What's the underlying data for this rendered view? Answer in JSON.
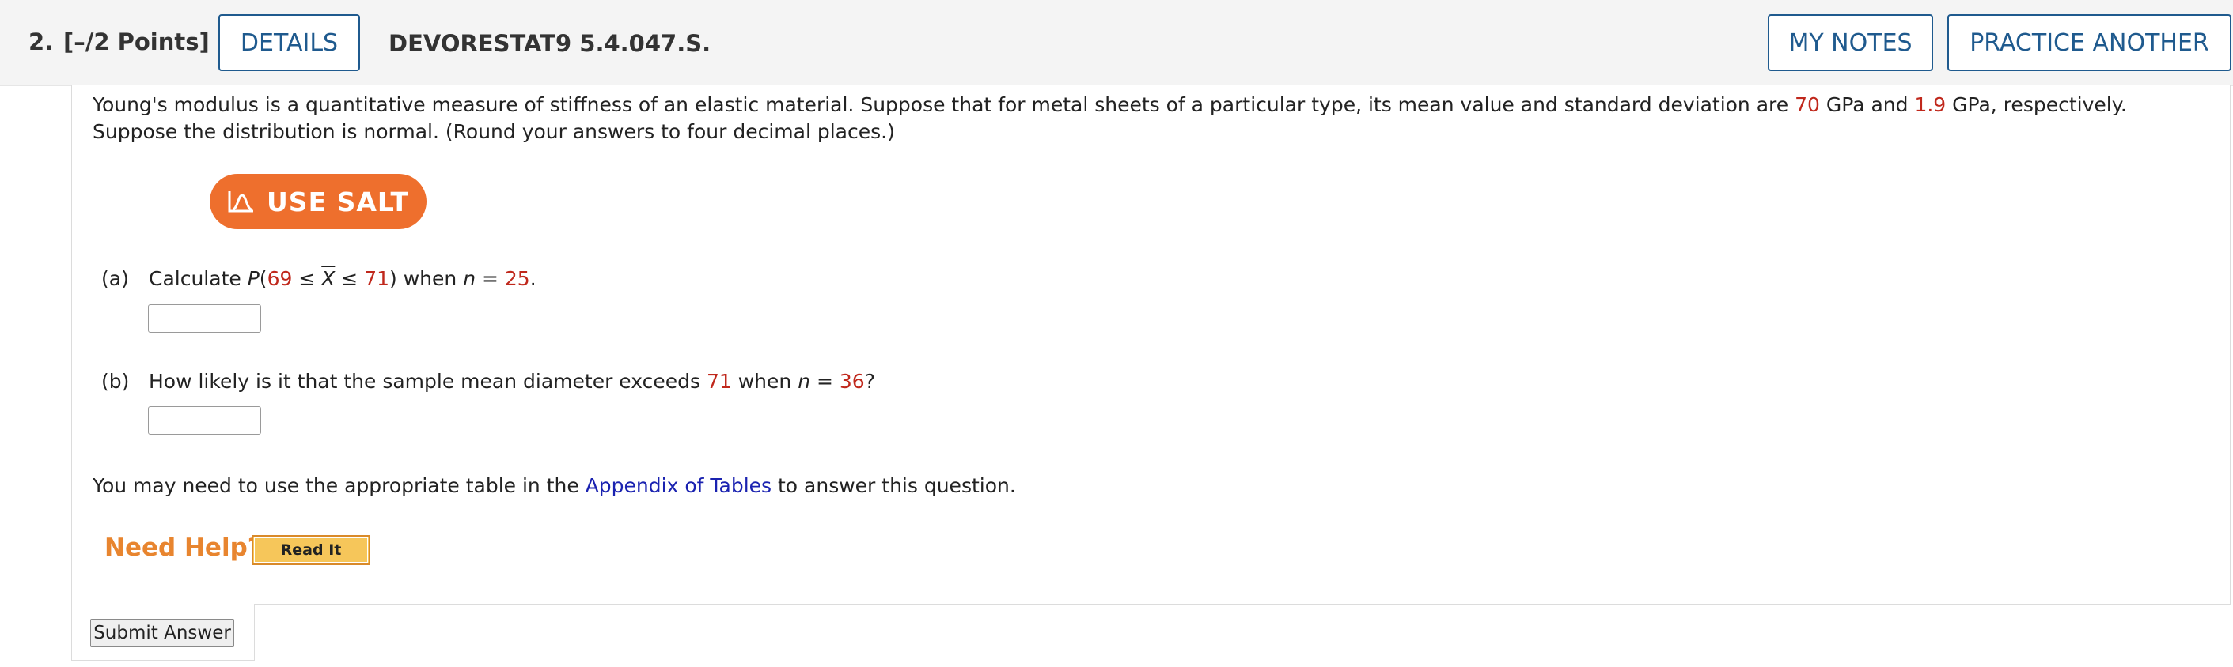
{
  "header": {
    "number": "2.",
    "points": "[–/2 Points]",
    "details_label": "DETAILS",
    "assignment": "DEVORESTAT9 5.4.047.S.",
    "my_notes_label": "MY NOTES",
    "practice_label": "PRACTICE ANOTHER"
  },
  "question": {
    "intro_1": "Young's modulus is a quantitative measure of stiffness of an elastic material. Suppose that for metal sheets of a particular type, its mean value and standard deviation are ",
    "mean": "70",
    "intro_2": " GPa and ",
    "sd": "1.9",
    "intro_3": " GPa, respectively. Suppose the distribution is normal. (Round your answers to four decimal places.)"
  },
  "salt": {
    "label": "USE SALT",
    "icon": "salt-chart-icon"
  },
  "part_a": {
    "tag": "(a)",
    "t1": "Calculate ",
    "p": "P",
    "t2": "(",
    "low": "69",
    "t3": " ≤ ",
    "xbar": "X",
    "t4": " ≤ ",
    "high": "71",
    "t5": ") when ",
    "n": "n",
    "t6": " = ",
    "n_val": "25",
    "t7": "."
  },
  "part_b": {
    "tag": "(b)",
    "t1": "How likely is it that the sample mean diameter exceeds ",
    "thresh": "71",
    "t2": " when ",
    "n": "n",
    "t3": " = ",
    "n_val": "36",
    "t4": "?"
  },
  "footnote": {
    "t1": "You may need to use the appropriate table in the ",
    "link": "Appendix of Tables",
    "t2": " to answer this question."
  },
  "help": {
    "label": "Need Help?",
    "read_it": "Read It"
  },
  "submit_label": "Submit Answer",
  "colors": {
    "accent": "#1f5a8e",
    "salt": "#ee6f2d",
    "value_red": "#c0281c",
    "help_orange": "#e8852f",
    "link_blue": "#1a22b0"
  }
}
